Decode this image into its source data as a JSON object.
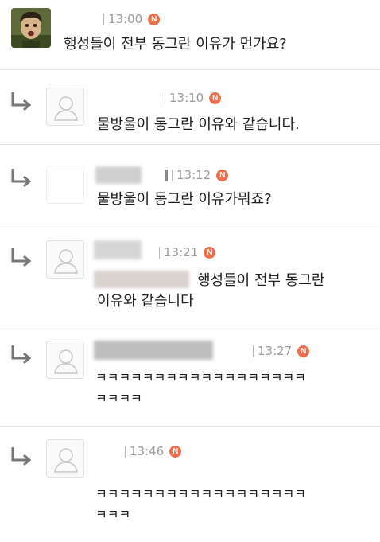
{
  "comments": [
    {
      "time": "13:00",
      "badge": "N",
      "text": "행성들이 전부 동그란 이유가 먼가요?"
    },
    {
      "time": "13:10",
      "badge": "N",
      "text": "물방울이 동그란 이유와 같습니다."
    },
    {
      "time": "13:12",
      "badge": "N",
      "text": "물방울이 동그란 이유가뭐죠?"
    },
    {
      "time": "13:21",
      "badge": "N",
      "text": "행성들이 전부 동그란",
      "text2": "이유와 같습니다"
    },
    {
      "time": "13:27",
      "badge": "N",
      "text": "ㅋㅋㅋㅋㅋㅋㅋㅋㅋㅋㅋㅋㅋㅋㅋㅋㅋㅋ",
      "text2": "ㅋㅋㅋㅋ"
    },
    {
      "time": "13:46",
      "badge": "N",
      "text": "ㅋㅋㅋㅋㅋㅋㅋㅋㅋㅋㅋㅋㅋㅋㅋㅋㅋㅋ",
      "text2": "ㅋㅋㅋ"
    }
  ],
  "icons": {
    "reply": "reply-arrow-icon",
    "avatar_default": "default-avatar-icon",
    "new": "new-badge-icon"
  },
  "colors": {
    "badge": "#ee6d4b",
    "meta_text": "#9a9a9a",
    "body_text": "#1c1c1c",
    "divider": "#e4e4e4"
  }
}
